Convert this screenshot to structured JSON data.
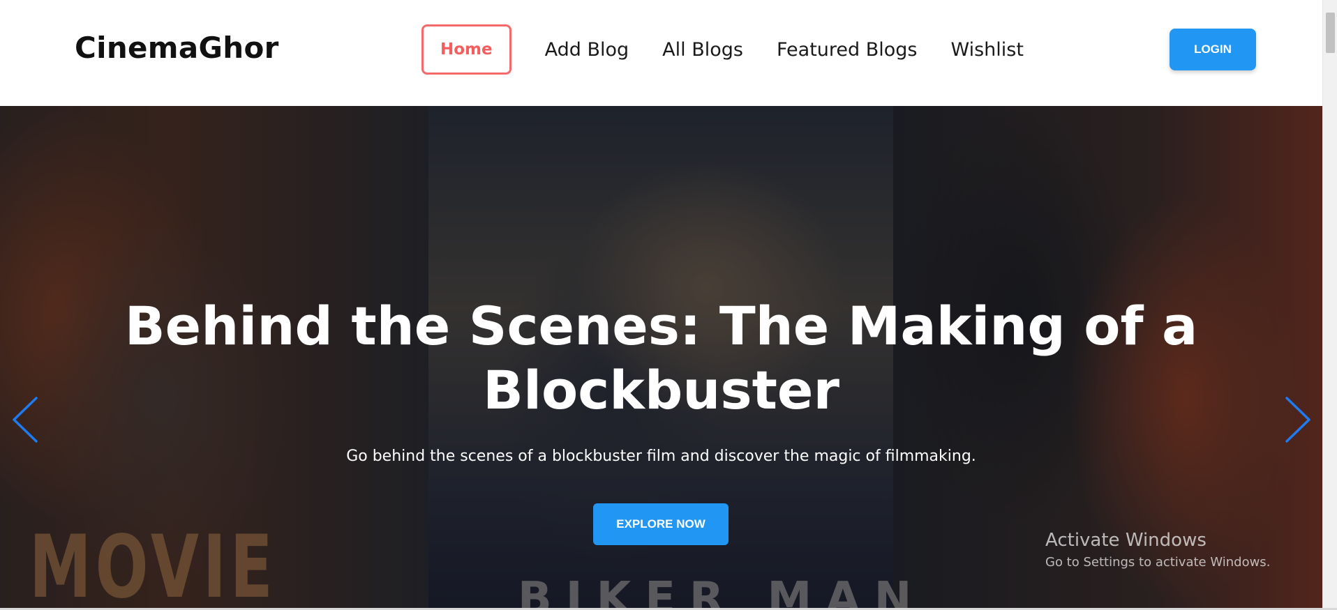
{
  "header": {
    "brand": "CinemaGhor",
    "nav": [
      {
        "label": "Home",
        "active": true
      },
      {
        "label": "Add Blog",
        "active": false
      },
      {
        "label": "All Blogs",
        "active": false
      },
      {
        "label": "Featured Blogs",
        "active": false
      },
      {
        "label": "Wishlist",
        "active": false
      }
    ],
    "login_label": "LOGIN"
  },
  "hero": {
    "title": "Behind the Scenes: The Making of a Blockbuster",
    "subtitle": "Go behind the scenes of a blockbuster film and discover the magic of filmmaking.",
    "cta_label": "EXPLORE NOW",
    "left_poster_text": "MOVIE",
    "center_poster_text": "BIKER MAN",
    "prev_icon": "chevron-left-icon",
    "next_icon": "chevron-right-icon"
  },
  "watermark": {
    "title": "Activate Windows",
    "subtitle": "Go to Settings to activate Windows."
  },
  "colors": {
    "accent": "#2196f3",
    "active_nav": "#f45e5e",
    "arrow": "#1e7bf0"
  }
}
